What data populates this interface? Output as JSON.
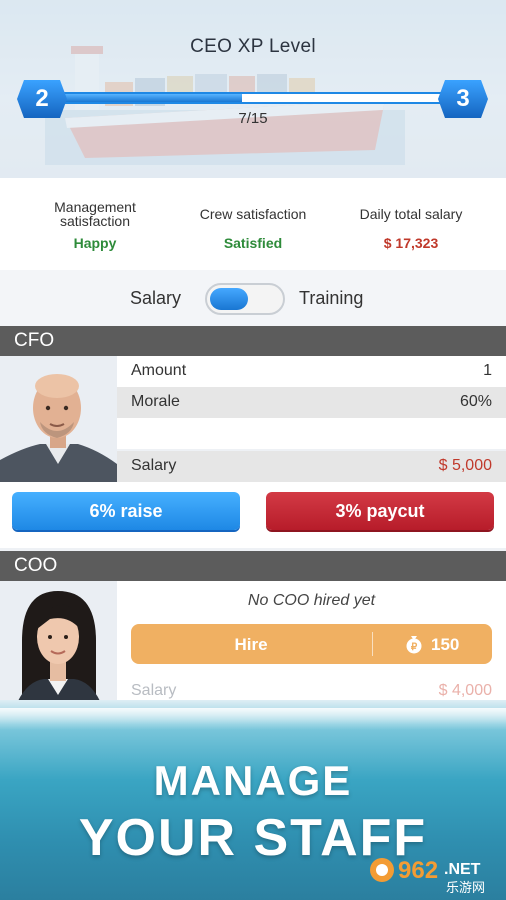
{
  "hero": {
    "title": "CEO XP Level",
    "level_current": "2",
    "level_next": "3",
    "xp_text": "7/15",
    "xp_progress": 0.47
  },
  "stats": [
    {
      "label_line1": "Management",
      "label_line2": "satisfaction",
      "value": "Happy",
      "color": "#2e8b3a"
    },
    {
      "label_line1": "Crew satisfaction",
      "label_line2": "",
      "value": "Satisfied",
      "color": "#2e8b3a"
    },
    {
      "label_line1": "Daily total salary",
      "label_line2": "",
      "value": "$ 17,323",
      "color": "#c0392b"
    }
  ],
  "toggle": {
    "left_label": "Salary",
    "right_label": "Training",
    "state": "Salary"
  },
  "cfo": {
    "header": "CFO",
    "rows": {
      "amount_label": "Amount",
      "amount_value": "1",
      "morale_label": "Morale",
      "morale_value": "60%",
      "salary_label": "Salary",
      "salary_value": "$ 5,000"
    },
    "raise_label": "6% raise",
    "paycut_label": "3% paycut"
  },
  "coo": {
    "header": "COO",
    "empty_text": "No COO hired yet",
    "hire_label": "Hire",
    "hire_cost": "150",
    "salary_label": "Salary",
    "salary_value": "$ 4,000"
  },
  "promo": {
    "line1": "MANAGE",
    "line2": "YOUR STAFF"
  },
  "watermark": {
    "brand": "962",
    "suffix": ".NET",
    "subtitle": "乐游网"
  },
  "colors": {
    "accent_blue": "#1e88e5",
    "paycut_red": "#b71c2a",
    "hire_orange": "#f0b062",
    "section_header": "#5c5c5c"
  }
}
